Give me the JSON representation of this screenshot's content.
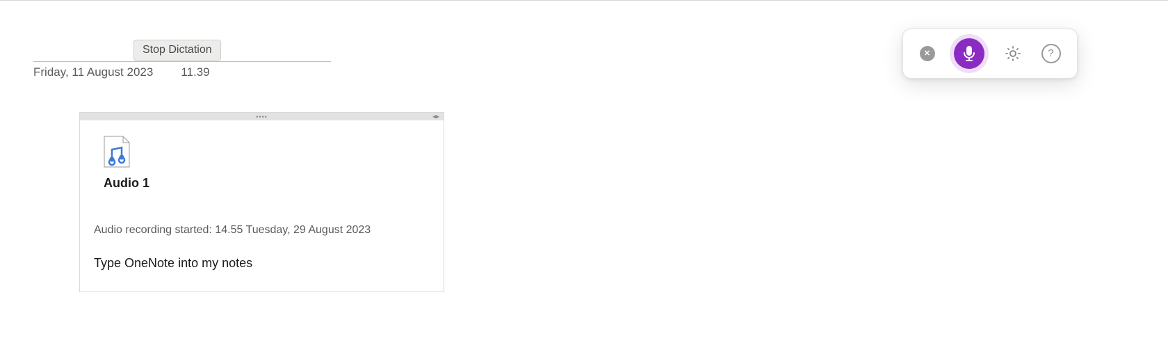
{
  "tooltip": {
    "stop_dictation": "Stop Dictation"
  },
  "header": {
    "date": "Friday, 11 August 2023",
    "time": "11.39"
  },
  "note": {
    "audio_title": "Audio 1",
    "recording_meta": "Audio recording started: 14.55 Tuesday, 29 August 2023",
    "dictated_text": "Type OneNote into my notes"
  },
  "toolbar": {
    "close_label": "✕",
    "help_label": "?"
  }
}
